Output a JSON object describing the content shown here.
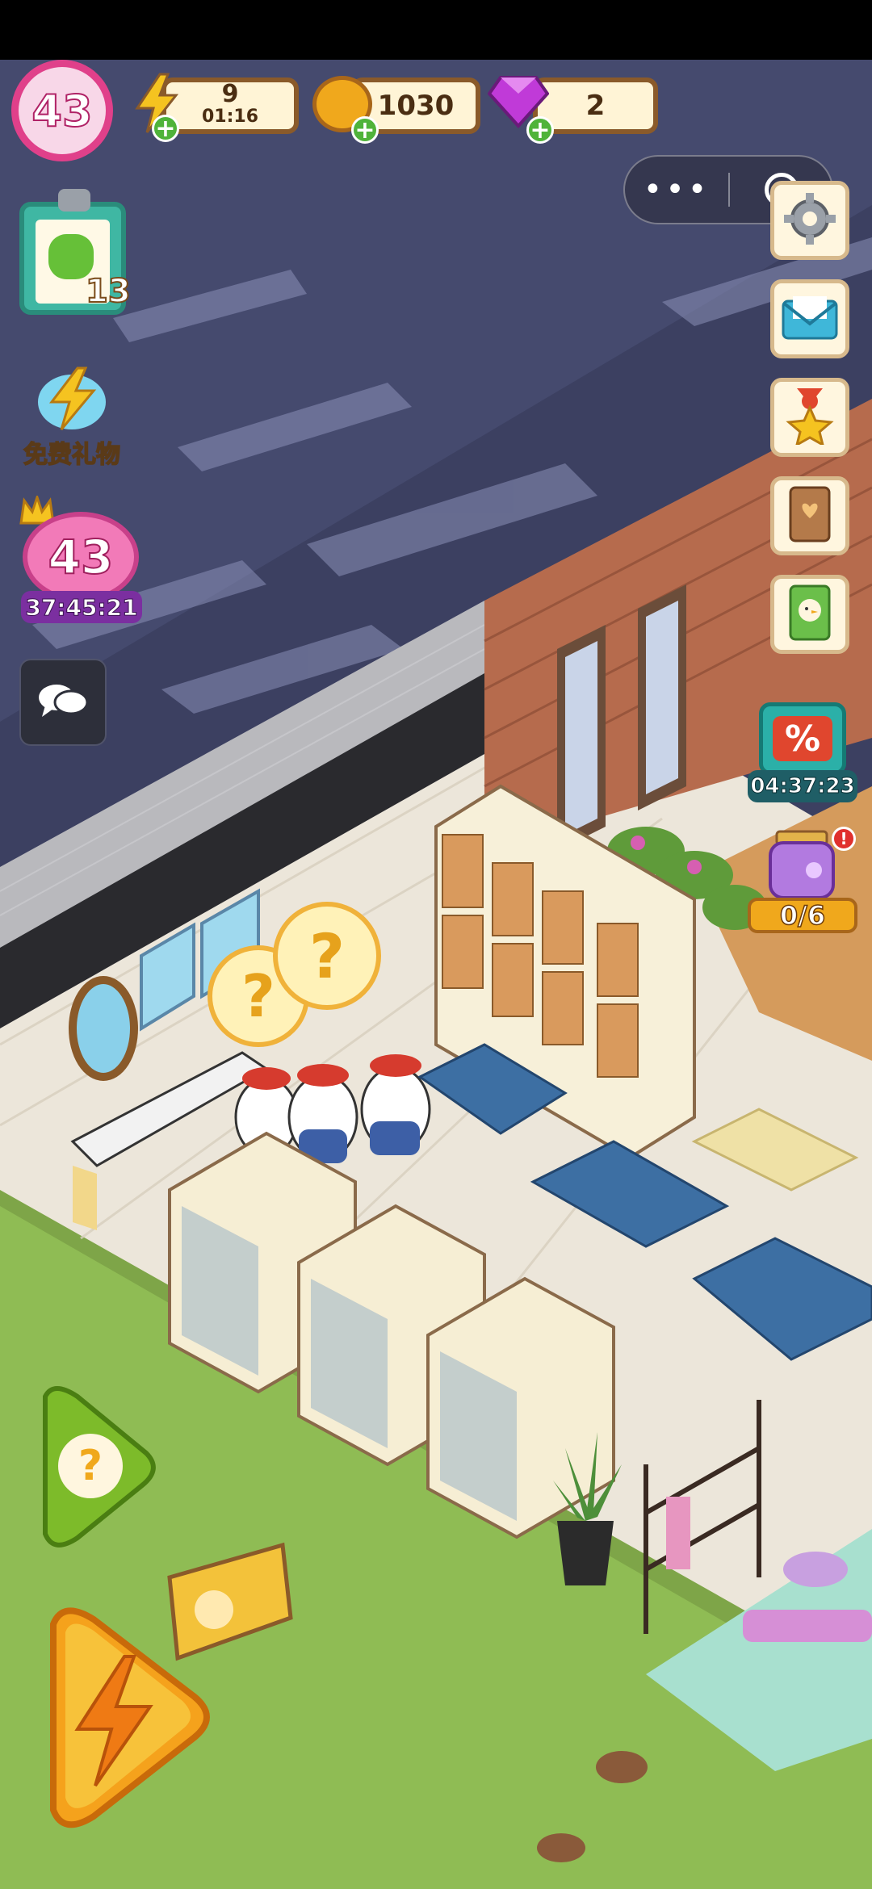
{
  "hud": {
    "level": "43",
    "energy": {
      "value": "9",
      "timer": "01:16"
    },
    "coins": "1030",
    "gems": "2"
  },
  "left_panel": {
    "task_count": "13",
    "free_gift_label": "免费礼物",
    "vip_level": "43",
    "vip_timer": "37:45:21"
  },
  "right_panel": {
    "sale_timer": "04:37:23",
    "jar_progress": "0/6"
  },
  "icons": {
    "settings": "gear-icon",
    "mail": "mail-icon",
    "achievements": "medal-icon",
    "book": "book-icon",
    "guide": "green-book-icon",
    "chat": "chat-icon",
    "hint": "question-leaf-icon",
    "boost": "lightning-icon"
  },
  "colors": {
    "level_ring": "#e0408a",
    "energy": "#f5c320",
    "coin": "#f0a81c",
    "gem": "#c03ad8",
    "floor": "#ece6da",
    "bench": "#3d6fa3",
    "grass": "#8fbc54"
  }
}
